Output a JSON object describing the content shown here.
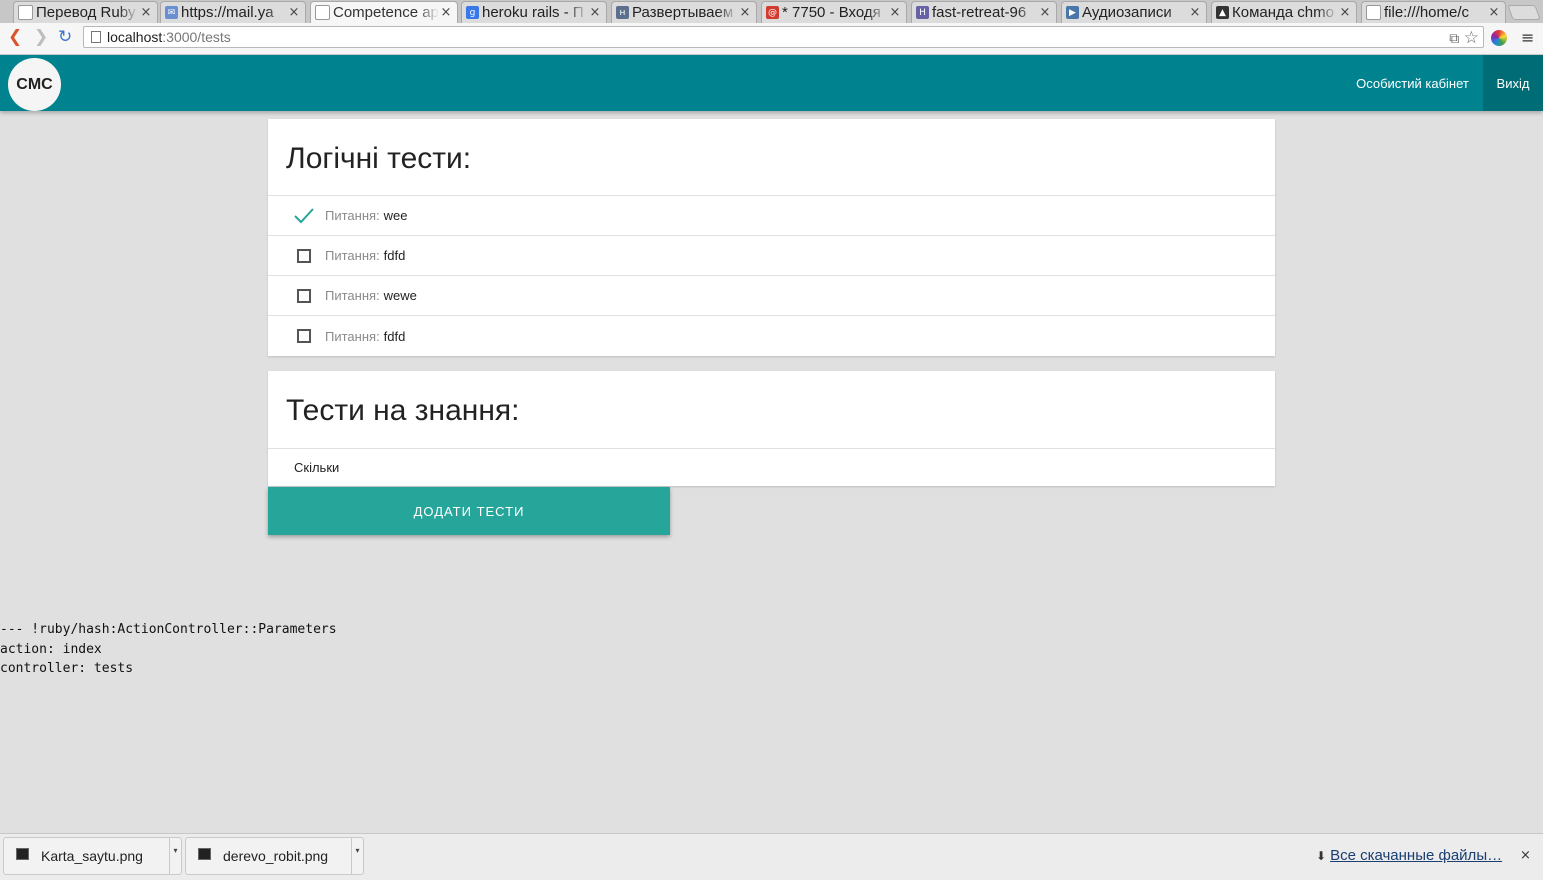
{
  "browser": {
    "tabs": [
      {
        "title": "Перевод Ruby",
        "favicon": "page-icon",
        "color": "#888888",
        "active": false
      },
      {
        "title": "https://mail.ya",
        "favicon": "mail-icon",
        "color": "#6a8fd0",
        "active": false
      },
      {
        "title": "Competence ap",
        "favicon": "page-icon",
        "color": "#888888",
        "active": true
      },
      {
        "title": "heroku rails - П",
        "favicon": "google-icon",
        "color": "#3b78e7",
        "active": false
      },
      {
        "title": "Развертываем",
        "favicon": "habr-icon",
        "color": "#5c6f8c",
        "active": false
      },
      {
        "title": "* 7750 - Входя",
        "favicon": "mail-ru-icon",
        "color": "#d23b2f",
        "active": false
      },
      {
        "title": "fast-retreat-96",
        "favicon": "heroku-icon",
        "color": "#6762a6",
        "active": false
      },
      {
        "title": "Аудиозаписи",
        "favicon": "vk-icon",
        "color": "#4a76a8",
        "active": false
      },
      {
        "title": "Команда chmo",
        "favicon": "linux-icon",
        "color": "#333333",
        "active": false
      },
      {
        "title": "file:///home/c",
        "favicon": "page-icon",
        "color": "#888888",
        "active": false
      }
    ],
    "close_glyph": "×",
    "back_glyph": "❮",
    "forward_glyph": "❯",
    "reload_glyph": "↻",
    "url_host": "localhost",
    "url_path": ":3000/tests",
    "star_glyph": "☆",
    "translate_glyph": "⧉",
    "menu_glyph": "≡"
  },
  "app": {
    "logo": "CMC",
    "nav": {
      "cabinet": "Особистий кабінет",
      "logout": "Вихід"
    },
    "accent": "#00838f",
    "logical_tests": {
      "title": "Логічні тести:",
      "question_prefix": "Питання:",
      "items": [
        {
          "text": "wee",
          "checked": true
        },
        {
          "text": "fdfd",
          "checked": false
        },
        {
          "text": "wewe",
          "checked": false
        },
        {
          "text": "fdfd",
          "checked": false
        }
      ]
    },
    "knowledge_tests": {
      "title": "Тести на знання:",
      "items": [
        "Скільки"
      ]
    },
    "add_button": "ДОДАТИ ТЕСТИ",
    "button_color": "#26a69a",
    "debug_lines": [
      "--- !ruby/hash:ActionController::Parameters",
      "action: index",
      "controller: tests"
    ]
  },
  "downloads": {
    "files": [
      "Karta_saytu.png",
      "derevo_robit.png"
    ],
    "arrow_glyph": "▾",
    "all_downloads": "Все скачанные файлы…",
    "download_glyph": "⬇",
    "close_glyph": "×"
  }
}
